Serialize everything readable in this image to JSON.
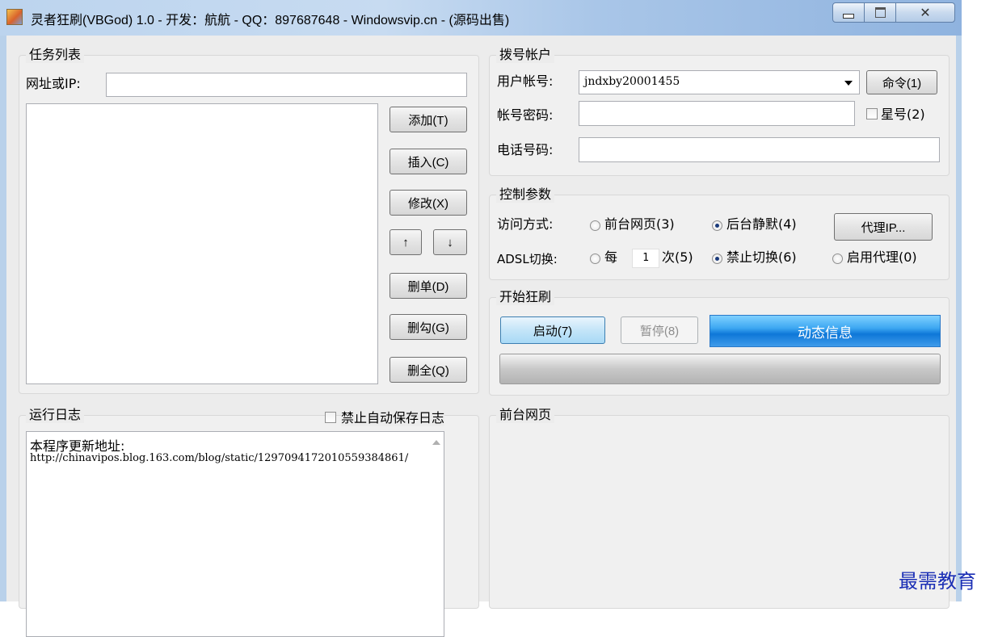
{
  "window": {
    "title": "灵者狂刷(VBGod) 1.0 - 开发：航航 - QQ：897687648 - Windowsvip.cn - (源码出售)",
    "close_glyph": "✕"
  },
  "task_list": {
    "group_title": "任务列表",
    "url_label": "网址或IP:",
    "url_value": "",
    "buttons": {
      "add": "添加(T)",
      "insert": "插入(C)",
      "modify": "修改(X)",
      "up": "↑",
      "down": "↓",
      "delete_single": "删单(D)",
      "delete_checked": "删勾(G)",
      "delete_all": "删全(Q)"
    }
  },
  "dial_account": {
    "group_title": "拨号帐户",
    "user_label": "用户帐号:",
    "user_value": "jndxby20001455",
    "command_button": "命令(1)",
    "password_label": "帐号密码:",
    "password_value": "",
    "star_checkbox": "星号(2)",
    "phone_label": "电话号码:",
    "phone_value": ""
  },
  "control": {
    "group_title": "控制参数",
    "access_label": "访问方式:",
    "access_options": [
      "前台网页(3)",
      "后台静默(4)"
    ],
    "access_selected": 1,
    "proxy_button": "代理IP...",
    "adsl_label": "ADSL切换:",
    "adsl_every_prefix": "每",
    "adsl_every_value": "1",
    "adsl_every_suffix": "次(5)",
    "adsl_disable": "禁止切换(6)",
    "adsl_proxy": "启用代理(0)",
    "adsl_selected": 1
  },
  "start": {
    "group_title": "开始狂刷",
    "start_button": "启动(7)",
    "pause_button": "暂停(8)",
    "dynamic_info": "动态信息",
    "progress": 0
  },
  "log": {
    "group_title": "运行日志",
    "no_autosave": "禁止自动保存日志",
    "heading": "本程序更新地址:",
    "url": "http://chinavipos.blog.163.com/blog/static/1297094172010559384861/"
  },
  "front_page": {
    "group_title": "前台网页"
  },
  "watermark": "最需教育"
}
